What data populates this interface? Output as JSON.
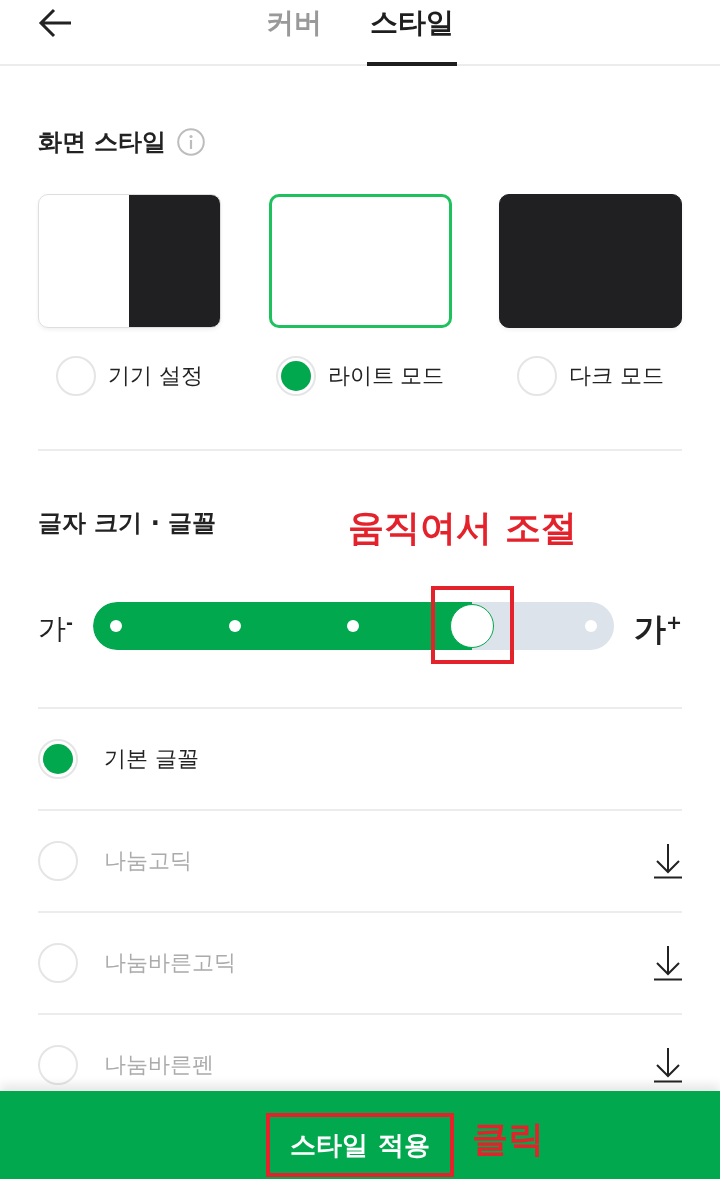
{
  "tabs": [
    {
      "label": "커버",
      "selected": false
    },
    {
      "label": "스타일",
      "selected": true
    }
  ],
  "screen_style": {
    "title": "화면 스타일",
    "options": [
      {
        "kind": "system",
        "label": "기기 설정",
        "selected": false
      },
      {
        "kind": "light",
        "label": "라이트 모드",
        "selected": true
      },
      {
        "kind": "dark",
        "label": "다크 모드",
        "selected": false
      }
    ]
  },
  "text_size_font": {
    "title": "글자 크기 · 글꼴",
    "note": "움직여서 조절",
    "slider": {
      "min_label": "가$^{-}$",
      "max_label": "가$^{+}$",
      "level": 0.75,
      "highlighted": true
    },
    "fonts": [
      {
        "label": "기본 글꼴",
        "selected": true,
        "downloaded": true
      },
      {
        "label": "나눔고딕",
        "selected": false,
        "downloaded": false
      },
      {
        "label": "나눔바른고딕",
        "selected": false,
        "downloaded": false
      },
      {
        "label": "나눔바른펜",
        "selected": false,
        "downloaded": false
      }
    ]
  },
  "apply_button": {
    "label": "스타일 적용",
    "highlighted": true,
    "note": "클릭"
  }
}
